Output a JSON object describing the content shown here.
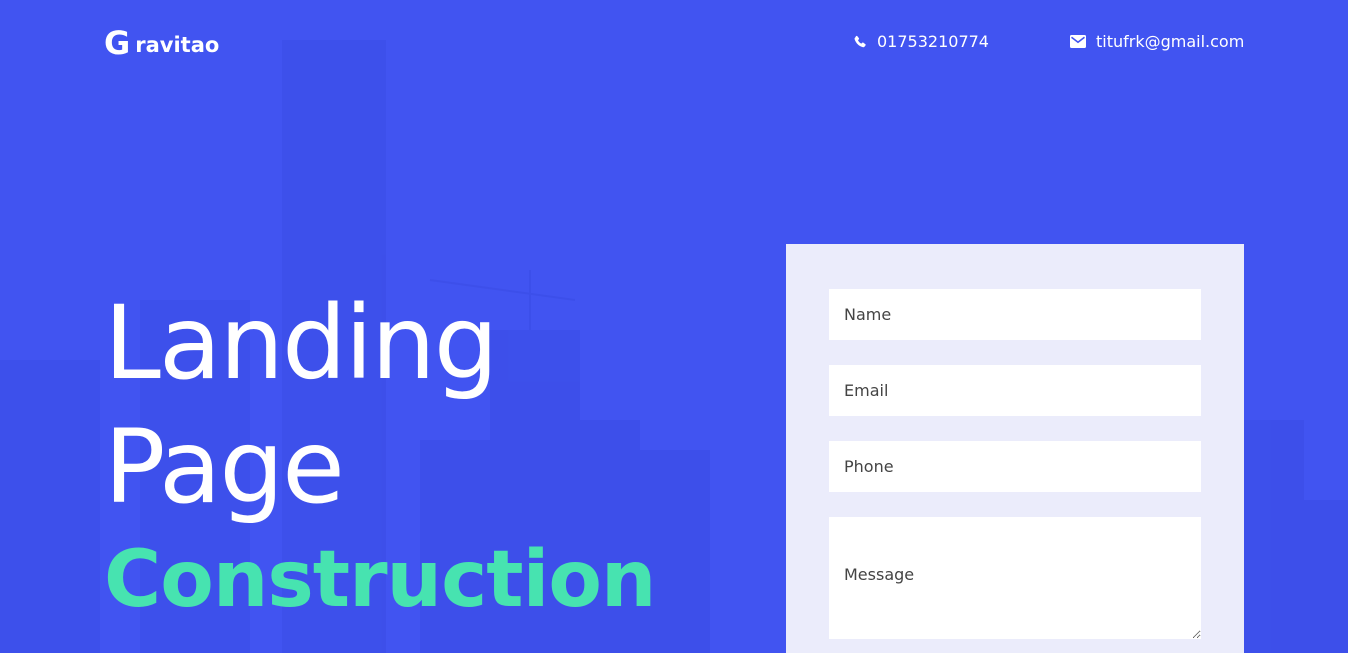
{
  "brand": {
    "logo_mark": "G",
    "logo_text": "ravitao"
  },
  "header": {
    "phone": "01753210774",
    "email": "titufrk@gmail.com"
  },
  "hero": {
    "line1": "Landing",
    "line2": "Page",
    "accent": "Construction"
  },
  "form": {
    "name_placeholder": "Name",
    "email_placeholder": "Email",
    "phone_placeholder": "Phone",
    "message_placeholder": "Message"
  },
  "colors": {
    "background": "#4154f1",
    "accent": "#47e3b0",
    "form_card": "#ebecfb"
  },
  "icons": {
    "phone": "phone-icon",
    "email": "envelope-icon"
  }
}
